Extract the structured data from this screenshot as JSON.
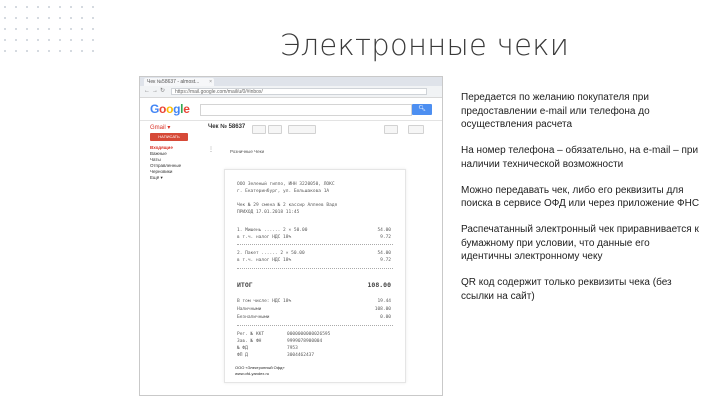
{
  "slide": {
    "title": "Электронные чеки",
    "bullets": [
      "Передается по желанию покупателя при предоставлении e-mail или телефона до осуществления расчета",
      "На номер телефона – обязательно, на e-mail – при наличии технической возможности",
      "Можно передавать чек, либо его реквизиты для поиска в сервисе ОФД или через приложение ФНС",
      "Распечатанный электронный чек приравнивается к бумажному при условии, что данные его идентичны электронному чеку",
      "QR код содержит только реквизиты чека (без ссылки на сайт)"
    ]
  },
  "browser": {
    "tab_title": "Чек №58637 - almost...",
    "url": "https://mail.google.com/mail/u/0/#inbox/",
    "logo_letters": [
      {
        "ch": "G",
        "color": "#4285f4"
      },
      {
        "ch": "o",
        "color": "#ea4335"
      },
      {
        "ch": "o",
        "color": "#fbbc05"
      },
      {
        "ch": "g",
        "color": "#4285f4"
      },
      {
        "ch": "l",
        "color": "#34a853"
      },
      {
        "ch": "e",
        "color": "#ea4335"
      }
    ],
    "search_icon": "search-icon",
    "gmail_label": "Gmail ▾",
    "subject": "Чек № 58637",
    "compose_label": "НАПИСАТЬ",
    "nav_items": [
      "Входящие",
      "Важные",
      "Чаты",
      "Отправленные",
      "Черновики",
      "Ещё ▾"
    ],
    "sender": "Розничные Чеки"
  },
  "receipt": {
    "header_lines": [
      "ООО Зеленый гиппо, ИНН 3220050, ЛОКС",
      "г. Екатеринбург, ул. Большакова 1А"
    ],
    "meta_lines": [
      "Чек № 29 смена № 2 кассир Алпеев Вадя",
      "ПРИХОД 17.01.2018 11:45"
    ],
    "items": [
      {
        "line1": "1. Мишень ...... 2 × 50.00",
        "line2": "     в т.ч. налог НДС 18%",
        "value1": "54.00",
        "value2": "9.72"
      },
      {
        "line1": "2. Пакет ...... 2 × 50.00",
        "line2": "     в т.ч. налог НДС 18%",
        "value1": "54.00",
        "value2": "9.72"
      }
    ],
    "total_label": "ИТОГ",
    "total_value": "108.00",
    "payments": [
      {
        "label": "В том числе: НДС 18%",
        "value": "19.44"
      },
      {
        "label": "Наличными",
        "value": "108.00"
      },
      {
        "label": "Безналичными",
        "value": "0.00"
      }
    ],
    "reqs": [
      {
        "label": "Рег. № ККТ",
        "value": "0000000000026595"
      },
      {
        "label": "Зав. № ФН",
        "value": "9999078900004"
      },
      {
        "label": "№ ФД",
        "value": "7953"
      },
      {
        "label": "ФП Д",
        "value": "3004462437"
      }
    ],
    "footer_lines": [
      "ООО «Электронный Офд»",
      "www.ofd-yandex.ru"
    ]
  }
}
